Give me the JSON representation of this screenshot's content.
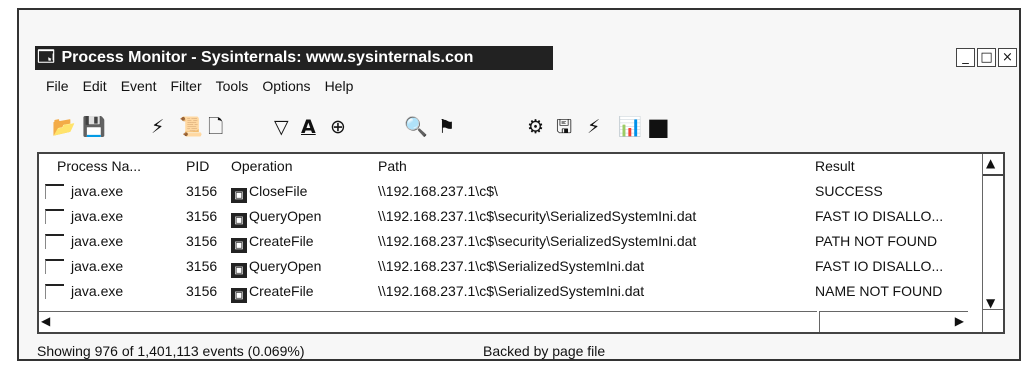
{
  "window": {
    "title": "Process Monitor - Sysinternals: www.sysinternals.con",
    "min": "_",
    "max": "□",
    "close": "×"
  },
  "menu": [
    "File",
    "Edit",
    "Event",
    "Filter",
    "Tools",
    "Options",
    "Help"
  ],
  "toolbar": [
    {
      "name": "open-icon",
      "glyph": "📂"
    },
    {
      "name": "save-icon",
      "glyph": "💾"
    },
    {
      "name": "capture-icon",
      "glyph": "⚡"
    },
    {
      "name": "autoscroll-icon",
      "glyph": "📜"
    },
    {
      "name": "clear-icon",
      "glyph": "🗋"
    },
    {
      "name": "filter-icon",
      "glyph": "▽"
    },
    {
      "name": "highlight-icon",
      "glyph": "A"
    },
    {
      "name": "network-icon",
      "glyph": "⊕"
    },
    {
      "name": "find-icon",
      "glyph": "🔍"
    },
    {
      "name": "jump-icon",
      "glyph": "⚑"
    },
    {
      "name": "registry-icon",
      "glyph": "⚙"
    },
    {
      "name": "filesystem-icon",
      "glyph": "🖫"
    },
    {
      "name": "process-activity-icon",
      "glyph": "⚡"
    },
    {
      "name": "profiling-icon",
      "glyph": "📊"
    },
    {
      "name": "black-square-icon",
      "glyph": "■"
    }
  ],
  "columns": {
    "process": "Process Na...",
    "pid": "PID",
    "operation": "Operation",
    "path": "Path",
    "result": "Result"
  },
  "rows": [
    {
      "process": "java.exe",
      "pid": "3156",
      "operation": "CloseFile",
      "path": "\\\\192.168.237.1\\c$\\",
      "result": "SUCCESS"
    },
    {
      "process": "java.exe",
      "pid": "3156",
      "operation": "QueryOpen",
      "path": "\\\\192.168.237.1\\c$\\security\\SerializedSystemIni.dat",
      "result": "FAST IO DISALLO..."
    },
    {
      "process": "java.exe",
      "pid": "3156",
      "operation": "CreateFile",
      "path": "\\\\192.168.237.1\\c$\\security\\SerializedSystemIni.dat",
      "result": "PATH NOT FOUND"
    },
    {
      "process": "java.exe",
      "pid": "3156",
      "operation": "QueryOpen",
      "path": "\\\\192.168.237.1\\c$\\SerializedSystemIni.dat",
      "result": "FAST IO DISALLO..."
    },
    {
      "process": "java.exe",
      "pid": "3156",
      "operation": "CreateFile",
      "path": "\\\\192.168.237.1\\c$\\SerializedSystemIni.dat",
      "result": "NAME NOT FOUND"
    }
  ],
  "status": {
    "events": "Showing 976 of 1,401,113 events (0.069%)",
    "backing": "Backed by page file"
  }
}
